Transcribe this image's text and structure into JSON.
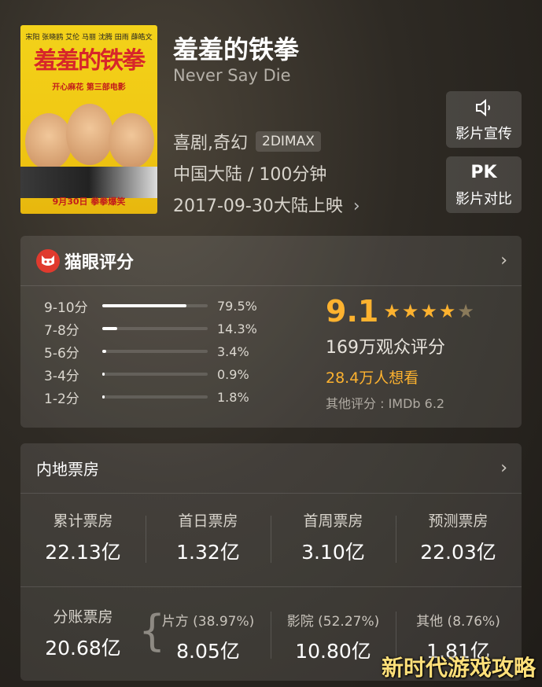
{
  "movie": {
    "title": "羞羞的铁拳",
    "subtitle": "Never Say Die",
    "genre": "喜剧,奇幻",
    "format_badge": "2DIMAX",
    "region_runtime": "中国大陆 / 100分钟",
    "release": "2017-09-30大陆上映",
    "poster": {
      "names": "宋阳 张晓鸥 艾伦 马丽 沈腾 田雨 薛皓文",
      "title": "羞羞的铁拳",
      "tagline": "开心麻花 第三部电影",
      "date_line": "9月30日 拳拳爆笑"
    }
  },
  "side_buttons": {
    "promo": {
      "icon": "speaker-icon",
      "label": "影片宣传"
    },
    "compare": {
      "icon_text": "PK",
      "label": "影片对比"
    }
  },
  "rating": {
    "header": "猫眼评分",
    "distribution": [
      {
        "label": "9-10分",
        "percent": "79.5%",
        "fraction": 0.795
      },
      {
        "label": "7-8分",
        "percent": "14.3%",
        "fraction": 0.143
      },
      {
        "label": "5-6分",
        "percent": "3.4%",
        "fraction": 0.034
      },
      {
        "label": "3-4分",
        "percent": "0.9%",
        "fraction": 0.009
      },
      {
        "label": "1-2分",
        "percent": "1.8%",
        "fraction": 0.018
      }
    ],
    "score": "9.1",
    "stars": 4.5,
    "votes": "169万观众评分",
    "wants": "28.4万人想看",
    "other": "其他评分 : IMDb 6.2"
  },
  "box_office": {
    "header": "内地票房",
    "top": [
      {
        "label": "累计票房",
        "value": "22.13亿"
      },
      {
        "label": "首日票房",
        "value": "1.32亿"
      },
      {
        "label": "首周票房",
        "value": "3.10亿"
      },
      {
        "label": "预测票房",
        "value": "22.03亿"
      }
    ],
    "split": {
      "label": "分账票房",
      "value": "20.68亿"
    },
    "breakdown": [
      {
        "label": "片方 (38.97%)",
        "value": "8.05亿"
      },
      {
        "label": "影院 (52.27%)",
        "value": "10.80亿"
      },
      {
        "label": "其他 (8.76%)",
        "value": "1.81亿"
      }
    ]
  },
  "watermark": "新时代游戏攻略",
  "colors": {
    "accent": "#fdb22f",
    "maoyan_red": "#e03a2e"
  }
}
